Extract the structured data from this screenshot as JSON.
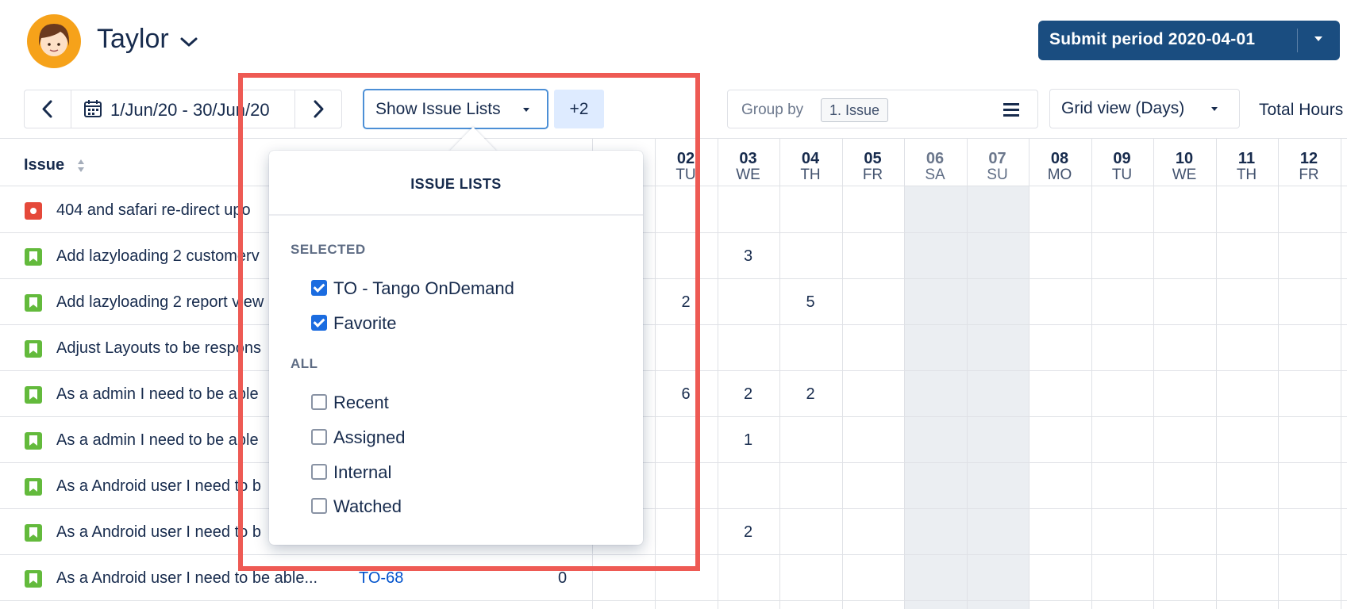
{
  "header": {
    "user_name": "Taylor",
    "submit_label": "Submit period 2020-04-01"
  },
  "toolbar": {
    "date_range": "1/Jun/20 - 30/Jun/20",
    "show_issue_lists": "Show Issue Lists",
    "extra_count": "+2",
    "group_by_label": "Group by",
    "group_by_value": "1. Issue",
    "view_mode": "Grid view (Days)",
    "total_hours": "Total Hours"
  },
  "table": {
    "issue_header": "Issue",
    "days": [
      {
        "num": "02",
        "wd": "TU",
        "weekend": false
      },
      {
        "num": "03",
        "wd": "WE",
        "weekend": false
      },
      {
        "num": "04",
        "wd": "TH",
        "weekend": false
      },
      {
        "num": "05",
        "wd": "FR",
        "weekend": false
      },
      {
        "num": "06",
        "wd": "SA",
        "weekend": true
      },
      {
        "num": "07",
        "wd": "SU",
        "weekend": true
      },
      {
        "num": "08",
        "wd": "MO",
        "weekend": false
      },
      {
        "num": "09",
        "wd": "TU",
        "weekend": false
      },
      {
        "num": "10",
        "wd": "WE",
        "weekend": false
      },
      {
        "num": "11",
        "wd": "TH",
        "weekend": false
      },
      {
        "num": "12",
        "wd": "FR",
        "weekend": false
      }
    ],
    "rows": [
      {
        "type": "bug",
        "title": "404 and safari re-direct upo",
        "key": "",
        "total": "",
        "cells": [
          "",
          "",
          "",
          "",
          "",
          "",
          "",
          "",
          "",
          "",
          ""
        ]
      },
      {
        "type": "story",
        "title": "Add lazyloading 2 customerv",
        "key": "",
        "total": "",
        "cells": [
          "",
          "3",
          "",
          "",
          "",
          "",
          "",
          "",
          "",
          "",
          ""
        ]
      },
      {
        "type": "story",
        "title": "Add lazyloading 2 report view",
        "key": "",
        "total": "",
        "cells": [
          "2",
          "",
          "5",
          "",
          "",
          "",
          "",
          "",
          "",
          "",
          ""
        ]
      },
      {
        "type": "story",
        "title": "Adjust Layouts to be respons",
        "key": "",
        "total": "",
        "cells": [
          "",
          "",
          "",
          "",
          "",
          "",
          "",
          "",
          "",
          "",
          ""
        ]
      },
      {
        "type": "story",
        "title": "As a admin I need to be able",
        "key": "",
        "total": "",
        "cells": [
          "6",
          "2",
          "2",
          "",
          "",
          "",
          "",
          "",
          "",
          "",
          ""
        ]
      },
      {
        "type": "story",
        "title": "As a admin I need to be able",
        "key": "",
        "total": "",
        "cells": [
          "",
          "1",
          "",
          "",
          "",
          "",
          "",
          "",
          "",
          "",
          ""
        ]
      },
      {
        "type": "story",
        "title": "As a Android user I need to b",
        "key": "",
        "total": "",
        "cells": [
          "",
          "",
          "",
          "",
          "",
          "",
          "",
          "",
          "",
          "",
          ""
        ]
      },
      {
        "type": "story",
        "title": "As a Android user I need to b",
        "key": "",
        "total": "",
        "cells": [
          "",
          "2",
          "",
          "",
          "",
          "",
          "",
          "",
          "",
          "",
          ""
        ]
      },
      {
        "type": "story",
        "title": "As a Android user I need to be able...",
        "key": "TO-68",
        "total": "0",
        "cells": [
          "",
          "",
          "",
          "",
          "",
          "",
          "",
          "",
          "",
          "",
          ""
        ]
      }
    ]
  },
  "popup": {
    "title": "ISSUE LISTS",
    "selected_label": "SELECTED",
    "selected": [
      {
        "label": "TO - Tango OnDemand",
        "checked": true
      },
      {
        "label": "Favorite",
        "checked": true
      }
    ],
    "all_label": "ALL",
    "all": [
      {
        "label": "Recent",
        "checked": false
      },
      {
        "label": "Assigned",
        "checked": false
      },
      {
        "label": "Internal",
        "checked": false
      },
      {
        "label": "Watched",
        "checked": false
      }
    ]
  },
  "icons": {
    "avatar": "user-avatar",
    "calendar": "calendar-icon",
    "prev": "chevron-left-icon",
    "next": "chevron-right-icon",
    "sort": "sort-icon",
    "menu": "hamburger-icon",
    "bug": "bug-icon",
    "story": "story-icon"
  },
  "colors": {
    "brand": "#1a4d80",
    "selection_highlight": "#ee5a54",
    "checkbox_on": "#1b6ce0",
    "link": "#0052cc",
    "bug": "#e5493a",
    "story": "#63ba3c"
  }
}
